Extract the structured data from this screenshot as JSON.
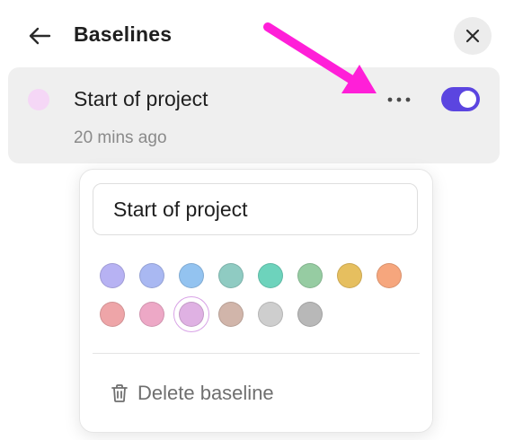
{
  "header": {
    "title": "Baselines",
    "back_icon": "arrow-left-icon",
    "close_icon": "close-icon"
  },
  "baseline": {
    "name": "Start of project",
    "time": "20 mins ago",
    "color": "#f5d7f6",
    "enabled": true,
    "toggle_color": "#5b45e0",
    "more_icon": "more-horizontal-icon"
  },
  "annotation": {
    "color": "#ff1fd8"
  },
  "popover": {
    "name_value": "Start of project",
    "colors_row1": [
      "#b7b2f3",
      "#a9b8f2",
      "#93c3f0",
      "#8fcbc2",
      "#6dd3bc",
      "#96cca2",
      "#e6bf5f",
      "#f6a67d"
    ],
    "colors_row2": [
      "#eea5a8",
      "#eda8c6",
      "#dfb1e3",
      "#d1b5aa",
      "#cecece",
      "#b8b8b8"
    ],
    "selected_color": "#dfb1e3",
    "delete_label": "Delete baseline",
    "delete_icon": "trash-icon"
  }
}
